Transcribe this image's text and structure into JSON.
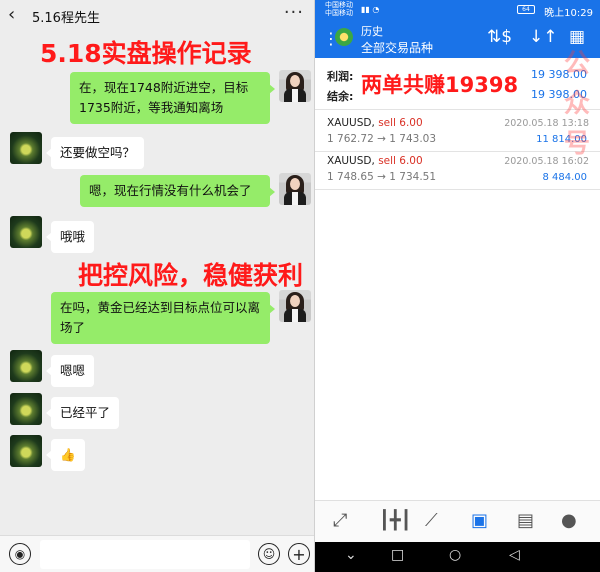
{
  "chat": {
    "back_icon": "‹",
    "title": "5.16程先生",
    "more_icon": "···",
    "overlay_title": "5.18实盘操作记录",
    "overlay_slogan": "把控风险，稳健获利",
    "messages": [
      {
        "side": "right",
        "text": "在，现在1748附近进空，目标1735附近，等我通知离场"
      },
      {
        "side": "left",
        "text": "还要做空吗？"
      },
      {
        "side": "right",
        "text": "嗯，现在行情没有什么机会了"
      },
      {
        "side": "left",
        "text": "哦哦"
      },
      {
        "side": "right",
        "text": "在吗，黄金已经达到目标点位可以离场了"
      },
      {
        "side": "left",
        "text": "嗯嗯"
      },
      {
        "side": "left",
        "text": "已经平了"
      },
      {
        "side": "left",
        "text": "👍"
      }
    ]
  },
  "mt4": {
    "status": {
      "carrier1": "中国移动",
      "carrier2": "中国移动",
      "battery": "64",
      "time": "晚上10:29"
    },
    "header": {
      "title": "历史",
      "subtitle": "全部交易品种"
    },
    "summary": {
      "profit_label": "利润:",
      "profit_value": "19 398.00",
      "balance_label": "结余:",
      "balance_value": "19 398.00",
      "overlay": "两单共赚19398"
    },
    "trades": [
      {
        "symbol": "XAUUSD,",
        "side": "sell 6.00",
        "open": "1 762.72",
        "arrow": "→",
        "close": "1 743.03",
        "date": "2020.05.18 13:18",
        "profit": "11 814.00"
      },
      {
        "symbol": "XAUUSD,",
        "side": "sell 6.00",
        "open": "1 748.65",
        "arrow": "→",
        "close": "1 734.51",
        "date": "2020.05.18 16:02",
        "profit": "8 484.00"
      }
    ],
    "watermark": "公众号"
  },
  "colors": {
    "accent": "#1a73e8",
    "wechat_green": "#95ec69",
    "overlay_red": "#ff1a1a",
    "sell_red": "#d93025"
  }
}
